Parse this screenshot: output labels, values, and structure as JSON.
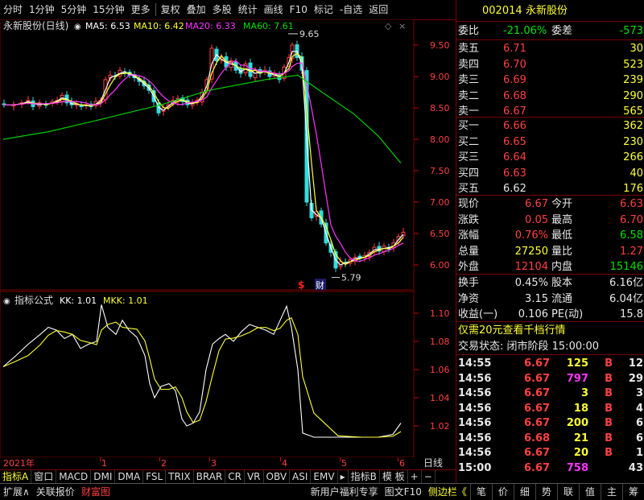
{
  "toolbar": {
    "items": [
      "分时",
      "1分钟",
      "5分钟",
      "15分钟",
      "更多",
      "复权",
      "叠加",
      "多股",
      "统计",
      "画线",
      "F10",
      "标记",
      "-自选",
      "返回"
    ]
  },
  "main_chart": {
    "title": "永新股份(日线)",
    "ma_labels": [
      {
        "name": "MA5: 6.53",
        "color": "#ffffff"
      },
      {
        "name": "MA10: 6.42",
        "color": "#ffff33"
      },
      {
        "name": "MA20: 6.33",
        "color": "#ff33ff"
      },
      {
        "name": "MA60: 7.61",
        "color": "#00dd00"
      }
    ],
    "price_axis": [
      "9.50",
      "9.00",
      "8.50",
      "8.00",
      "7.50",
      "7.00",
      "6.50",
      "6.00"
    ],
    "high_label": "9.65",
    "low_label": "5.79",
    "markers": [
      "$",
      "财"
    ]
  },
  "indicator": {
    "title": "指标公式",
    "kk": "KK: 1.01",
    "mkk": "MKK: 1.01",
    "axis": [
      "1.10",
      "1.08",
      "1.06",
      "1.04",
      "1.02"
    ]
  },
  "date_axis": {
    "labels": [
      "2021年",
      "1",
      "2",
      "3",
      "4",
      "5",
      "6"
    ],
    "right_label": "日线"
  },
  "bottom_tabs": [
    "指标A",
    "窗口",
    "MACD",
    "DMI",
    "DMA",
    "FSL",
    "TRIX",
    "BRAR",
    "CR",
    "VR",
    "OBV",
    "ASI",
    "EMV",
    "▸",
    "指标B",
    "模 板",
    "+",
    "−"
  ],
  "status_bar": {
    "left": [
      "扩展∧",
      "关联报价",
      "财富图"
    ],
    "middle": [
      "新用户福利专享",
      "图文F10",
      "侧边栏《"
    ],
    "right": [
      "笔",
      "价",
      "细",
      "势",
      "联",
      "值",
      "主",
      "筹"
    ]
  },
  "quote": {
    "code": "002014",
    "name": "永新股份",
    "weibi_label": "委比",
    "weibi": "-21.06%",
    "weicha_label": "委差",
    "weicha": "-573",
    "sell": [
      {
        "label": "卖五",
        "price": "6.71",
        "vol": "30"
      },
      {
        "label": "卖四",
        "price": "6.70",
        "vol": "523"
      },
      {
        "label": "卖三",
        "price": "6.69",
        "vol": "239"
      },
      {
        "label": "卖二",
        "price": "6.68",
        "vol": "290"
      },
      {
        "label": "卖一",
        "price": "6.67",
        "vol": "565"
      }
    ],
    "buy": [
      {
        "label": "买一",
        "price": "6.66",
        "vol": "362"
      },
      {
        "label": "买二",
        "price": "6.65",
        "vol": "230"
      },
      {
        "label": "买三",
        "price": "6.64",
        "vol": "266"
      },
      {
        "label": "买四",
        "price": "6.63",
        "vol": "40"
      },
      {
        "label": "买五",
        "price": "6.62",
        "vol": "176"
      }
    ],
    "stats": [
      {
        "l1": "现价",
        "v1": "6.67",
        "l2": "今开",
        "v2": "6.63"
      },
      {
        "l1": "涨跌",
        "v1": "0.05",
        "l2": "最高",
        "v2": "6.70"
      },
      {
        "l1": "涨幅",
        "v1": "0.76%",
        "l2": "最低",
        "v2": "6.58"
      },
      {
        "l1": "总量",
        "v1": "27250",
        "l2": "量比",
        "v2": "1.27"
      },
      {
        "l1": "外盘",
        "v1": "12104",
        "l2": "内盘",
        "v2": "15146"
      }
    ],
    "stats2": [
      {
        "l1": "换手",
        "v1": "0.45%",
        "l2": "股本",
        "v2": "6.16亿"
      },
      {
        "l1": "净资",
        "v1": "3.15",
        "l2": "流通",
        "v2": "6.04亿"
      },
      {
        "l1": "收益(一)",
        "v1": "0.106",
        "l2": "PE(动)",
        "v2": "15.8"
      }
    ],
    "promo": "仅需20元查看千档行情",
    "trade_status": "交易状态: 闭市阶段 15:00:00",
    "ticks": [
      {
        "time": "14:55",
        "price": "6.67",
        "vol": "125",
        "bs": "B",
        "n": "12"
      },
      {
        "time": "14:56",
        "price": "6.67",
        "vol": "797",
        "bs": "B",
        "n": "29"
      },
      {
        "time": "14:56",
        "price": "6.67",
        "vol": "3",
        "bs": "B",
        "n": "3"
      },
      {
        "time": "14:56",
        "price": "6.67",
        "vol": "18",
        "bs": "B",
        "n": "4"
      },
      {
        "time": "14:56",
        "price": "6.67",
        "vol": "200",
        "bs": "B",
        "n": "6"
      },
      {
        "time": "14:56",
        "price": "6.68",
        "vol": "21",
        "bs": "B",
        "n": "6"
      },
      {
        "time": "14:56",
        "price": "6.67",
        "vol": "20",
        "bs": "B",
        "n": "1"
      },
      {
        "time": "15:00",
        "price": "6.67",
        "vol": "758",
        "bs": "",
        "n": "43"
      }
    ]
  }
}
